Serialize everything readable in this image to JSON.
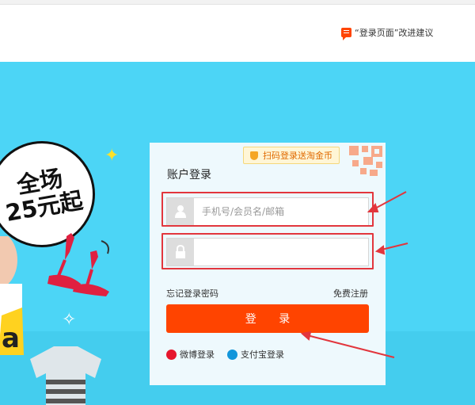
{
  "feedback": {
    "text": "“登录页面”改进建议",
    "icon": "feedback-icon"
  },
  "banner": {
    "promo_line1": "全场",
    "promo_line2": "25元起",
    "background_color": "#4cd5f6"
  },
  "login": {
    "title": "账户登录",
    "qr_tag": "扫码登录送淘金币",
    "username": {
      "placeholder": "手机号/会员名/邮箱",
      "value": "",
      "icon": "user-icon"
    },
    "password": {
      "placeholder": "",
      "value": "",
      "icon": "lock-icon"
    },
    "forgot": "忘记登录密码",
    "register": "免费注册",
    "submit": "登 录",
    "social": [
      {
        "label": "微博登录",
        "icon": "weibo-icon",
        "color": "#e6162d"
      },
      {
        "label": "支付宝登录",
        "icon": "alipay-icon",
        "color": "#1296db"
      }
    ]
  },
  "colors": {
    "accent": "#ff4400",
    "annotation": "#e2363d",
    "panel_bg": "#eef9fd"
  }
}
